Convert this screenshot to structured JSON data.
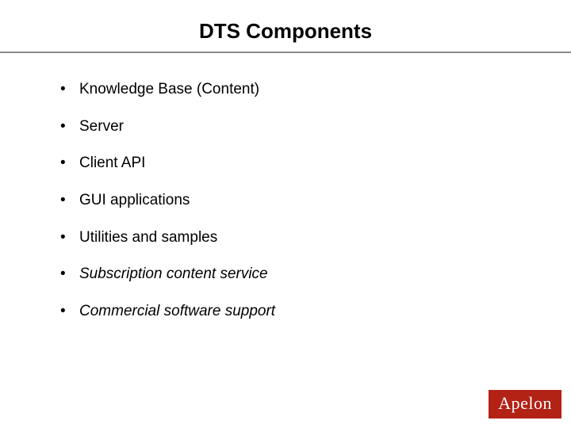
{
  "title": "DTS Components",
  "bullets": [
    {
      "text": "Knowledge Base (Content)",
      "italic": false
    },
    {
      "text": "Server",
      "italic": false
    },
    {
      "text": "Client API",
      "italic": false
    },
    {
      "text": "GUI applications",
      "italic": false
    },
    {
      "text": "Utilities and samples",
      "italic": false
    },
    {
      "text": "Subscription content service",
      "italic": true
    },
    {
      "text": "Commercial software support",
      "italic": true
    }
  ],
  "logo": "Apelon"
}
